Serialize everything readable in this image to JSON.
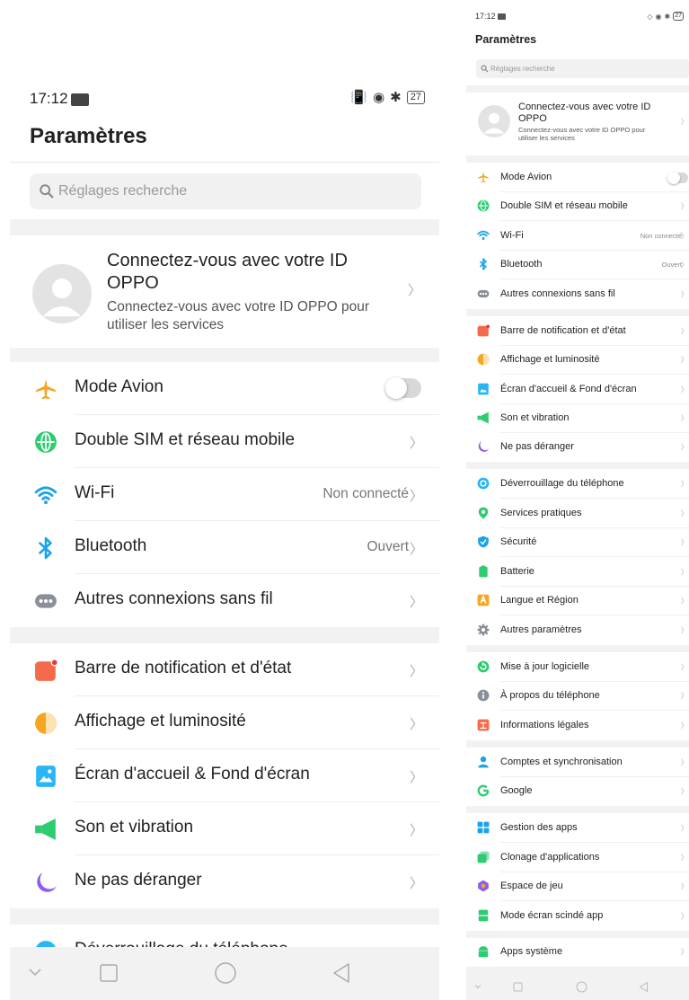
{
  "status_bar": {
    "time": "17:12",
    "battery": "27"
  },
  "header": {
    "title": "Paramètres"
  },
  "search": {
    "placeholder": "Réglages recherche"
  },
  "account": {
    "title": "Connectez-vous avec votre ID OPPO",
    "subtitle": "Connectez-vous avec votre ID OPPO pour utiliser les services"
  },
  "items": {
    "airplane": {
      "label": "Mode Avion"
    },
    "dual_sim": {
      "label": "Double SIM et réseau mobile"
    },
    "wifi": {
      "label": "Wi-Fi",
      "value": "Non connecté"
    },
    "bluetooth": {
      "label": "Bluetooth",
      "value": "Ouvert"
    },
    "other_wireless": {
      "label": "Autres connexions sans fil"
    },
    "notification_bar": {
      "label": "Barre de notification et d'état"
    },
    "display": {
      "label": "Affichage et luminosité"
    },
    "home_wallpaper": {
      "label": "Écran d'accueil & Fond d'écran"
    },
    "sound": {
      "label": "Son et vibration"
    },
    "dnd": {
      "label": "Ne pas déranger"
    },
    "unlock": {
      "label": "Déverrouillage du téléphone"
    },
    "convenience": {
      "label": "Services pratiques"
    },
    "security": {
      "label": "Sécurité"
    },
    "battery": {
      "label": "Batterie"
    },
    "language": {
      "label": "Langue et Région"
    },
    "other_settings": {
      "label": "Autres paramètres"
    },
    "software_update": {
      "label": "Mise à jour logicielle"
    },
    "about": {
      "label": "À propos du téléphone"
    },
    "legal": {
      "label": "Informations légales"
    },
    "accounts": {
      "label": "Comptes et synchronisation"
    },
    "google": {
      "label": "Google"
    },
    "app_management": {
      "label": "Gestion des apps"
    },
    "app_clone": {
      "label": "Clonage d'applications"
    },
    "game_space": {
      "label": "Espace de jeu"
    },
    "split_screen": {
      "label": "Mode écran scindé app"
    },
    "system_apps": {
      "label": "Apps système"
    }
  },
  "icons": {
    "airplane": "airplane-icon",
    "dual_sim": "globe-icon",
    "wifi": "wifi-icon",
    "bluetooth": "bluetooth-icon",
    "other_wireless": "more-dots-icon",
    "notification_bar": "notification-bar-icon",
    "display": "brightness-icon",
    "home_wallpaper": "wallpaper-icon",
    "sound": "speaker-icon",
    "dnd": "moon-icon",
    "unlock": "unlock-icon",
    "convenience": "location-pin-icon",
    "security": "shield-icon",
    "battery": "battery-icon",
    "language": "language-icon",
    "other_settings": "gear-icon",
    "software_update": "update-icon",
    "about": "info-icon",
    "legal": "legal-icon",
    "accounts": "person-icon",
    "google": "google-icon",
    "app_management": "apps-grid-icon",
    "app_clone": "clone-icon",
    "game_space": "game-icon",
    "split_screen": "split-screen-icon",
    "system_apps": "android-icon"
  },
  "toggles": {
    "airplane_on": false
  },
  "colors": {
    "airplane": "#f5a623",
    "green": "#2ecc71",
    "blue": "#1aa3e8",
    "orange_red": "#f46a4a",
    "purple": "#8b5cf6",
    "gray_icon": "#8a8f99"
  }
}
